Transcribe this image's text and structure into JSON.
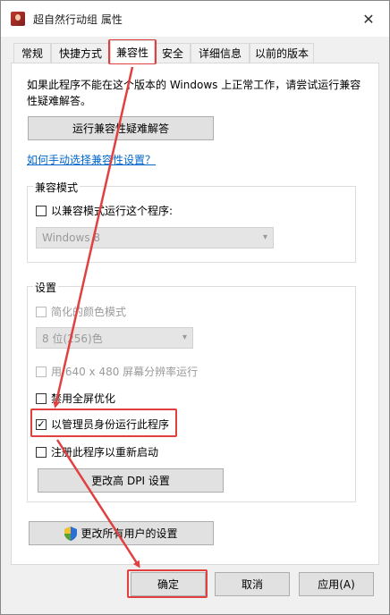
{
  "window": {
    "title": "超自然行动组 属性"
  },
  "tabs": [
    {
      "label": "常规"
    },
    {
      "label": "快捷方式"
    },
    {
      "label": "兼容性"
    },
    {
      "label": "安全"
    },
    {
      "label": "详细信息"
    },
    {
      "label": "以前的版本"
    }
  ],
  "compat": {
    "intro": "如果此程序不能在这个版本的 Windows 上正常工作，请尝试运行兼容性疑难解答。",
    "troubleshoot_button": "运行兼容性疑难解答",
    "manual_link": "如何手动选择兼容性设置？",
    "mode_group": {
      "label": "兼容模式",
      "checkbox": "以兼容模式运行这个程序:",
      "os_select": "Windows 8"
    },
    "settings_group": {
      "label": "设置",
      "reduced_color": "简化的颜色模式",
      "color_select": "8 位(256)色",
      "low_res": "用 640 x 480 屏幕分辨率运行",
      "fullscreen_opt": "禁用全屏优化",
      "run_as_admin": "以管理员身份运行此程序",
      "register_restart": "注册此程序以重新启动",
      "dpi_button": "更改高 DPI 设置"
    },
    "all_users_button": "更改所有用户的设置"
  },
  "footer": {
    "ok": "确定",
    "cancel": "取消",
    "apply": "应用(A)"
  },
  "checks": {
    "run_as_admin": "✓"
  },
  "colors": {
    "highlight": "#e04040",
    "link": "#0066cc"
  }
}
